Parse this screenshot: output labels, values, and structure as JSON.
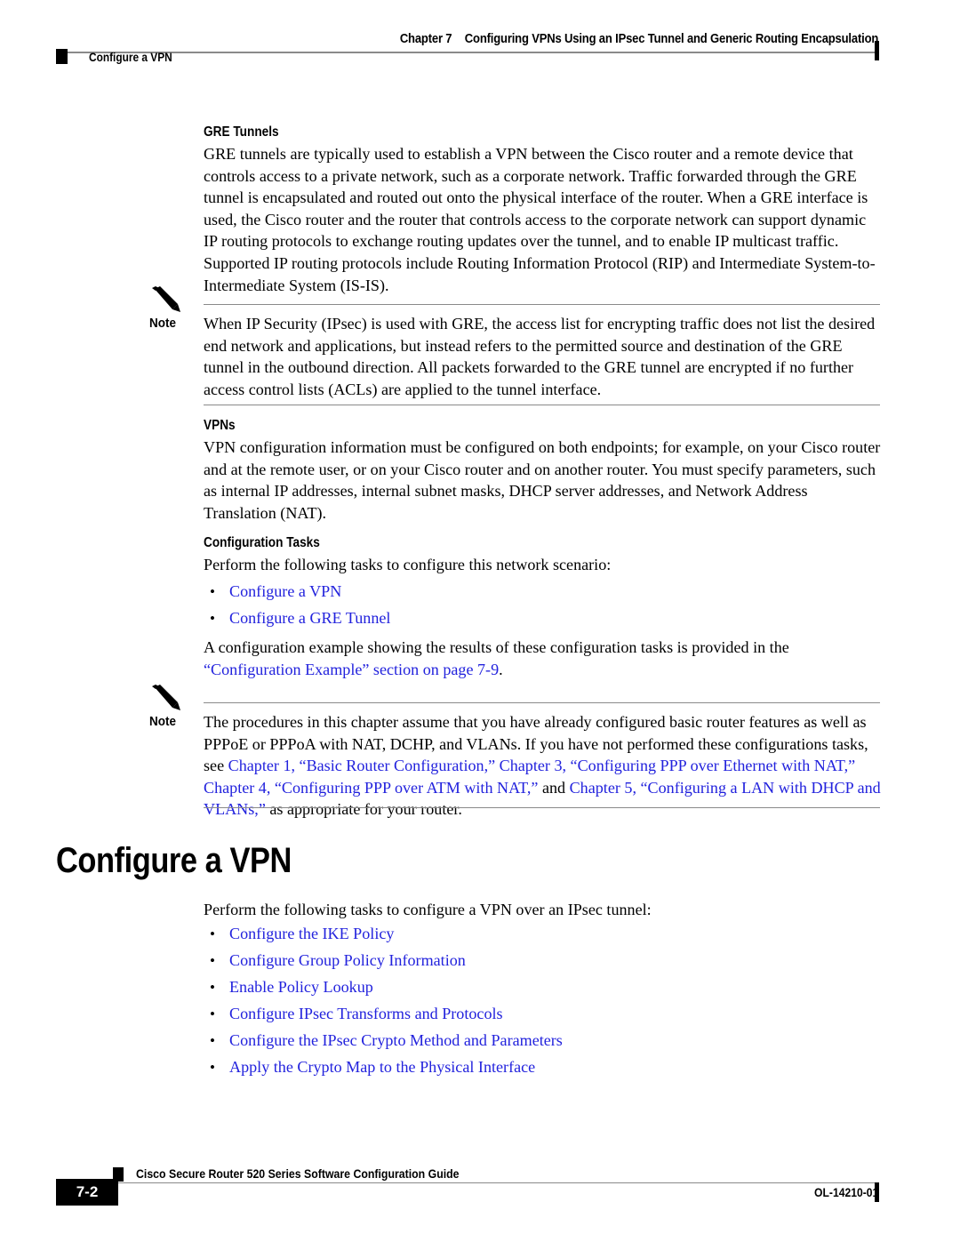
{
  "header": {
    "chapter_number": "Chapter 7",
    "chapter_title": "Configuring VPNs Using an IPsec Tunnel and Generic Routing Encapsulation",
    "section_marker": "Configure a VPN"
  },
  "sections": {
    "gre_tunnels": {
      "heading": "GRE Tunnels",
      "paragraph": "GRE tunnels are typically used to establish a VPN between the Cisco router and a remote device that controls access to a private network, such as a corporate network. Traffic forwarded through the GRE tunnel is encapsulated and routed out onto the physical interface of the router. When a GRE interface is used, the Cisco router and the router that controls access to the corporate network can support dynamic IP routing protocols to exchange routing updates over the tunnel, and to enable IP multicast traffic. Supported IP routing protocols include Routing Information Protocol (RIP) and Intermediate System-to-Intermediate System (IS-IS)."
    },
    "note_1": {
      "label": "Note",
      "icon": "pencil-icon",
      "text": "When IP Security (IPsec) is used with GRE, the access list for encrypting traffic does not list the desired end network and applications, but instead refers to the permitted source and destination of the GRE tunnel in the outbound direction. All packets forwarded to the GRE tunnel are encrypted if no further access control lists (ACLs) are applied to the tunnel interface."
    },
    "vpns": {
      "heading": "VPNs",
      "paragraph": "VPN configuration information must be configured on both endpoints; for example, on your Cisco router and at the remote user, or on your Cisco router and on another router. You must specify parameters, such as internal IP addresses, internal subnet masks, DHCP server addresses, and Network Address Translation (NAT)."
    },
    "configuration_tasks": {
      "heading": "Configuration Tasks",
      "intro": "Perform the following tasks to configure this network scenario:",
      "links": [
        "Configure a VPN",
        "Configure a GRE Tunnel"
      ],
      "outro_plain": "A configuration example showing the results of these configuration tasks is provided in the ",
      "outro_link": "“Configuration Example” section on page 7-9",
      "outro_tail": "."
    },
    "note_2": {
      "label": "Note",
      "icon": "pencil-icon",
      "part_1": "The procedures in this chapter assume that you have already configured basic router features as well as PPPoE or PPPoA with NAT, DCHP, and VLANs. If you have not performed these configurations tasks, see ",
      "link_1": "Chapter 1, “Basic Router Configuration,”",
      "sep_1": " ",
      "link_2": "Chapter 3, “Configuring PPP over Ethernet with NAT,”",
      "sep_2": " ",
      "link_3": "Chapter 4, “Configuring PPP over ATM with NAT,”",
      "sep_3": " and ",
      "link_4": "Chapter 5, “Configuring a LAN with DHCP and VLANs,”",
      "tail": " as appropriate for your router."
    },
    "configure_a_vpn": {
      "heading": "Configure a VPN",
      "intro": "Perform the following tasks to configure a VPN over an IPsec tunnel:",
      "links": [
        "Configure the IKE Policy",
        "Configure Group Policy Information",
        "Enable Policy Lookup",
        "Configure IPsec Transforms and Protocols",
        "Configure the IPsec Crypto Method and Parameters",
        "Apply the Crypto Map to the Physical Interface"
      ]
    }
  },
  "footer": {
    "page_number": "7-2",
    "document_title": "Cisco Secure Router 520 Series Software Configuration Guide",
    "document_id": "OL-14210-01"
  },
  "colors": {
    "link": "#2222dd",
    "rule": "#8a8a8a",
    "text": "#000000"
  }
}
